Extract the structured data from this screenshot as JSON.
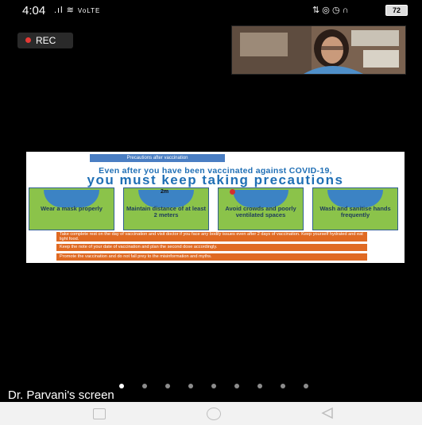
{
  "status_bar": {
    "time": "4:04",
    "network": "VoLTE",
    "battery": "72",
    "icons": [
      "signal-icon",
      "wifi-icon",
      "data-icon",
      "alarm-icon",
      "headphones-icon",
      "battery-icon"
    ]
  },
  "recording": {
    "label": "REC"
  },
  "slide": {
    "header": "Precautions after vaccination",
    "line1": "Even after you have been vaccinated against COVID-19,",
    "line2": "you must keep taking precautions",
    "panels": [
      {
        "label": "Wear a mask properly"
      },
      {
        "badge": "2m",
        "label": "Maintain distance of at least 2 meters"
      },
      {
        "label": "Avoid crowds and poorly ventilated spaces"
      },
      {
        "label": "Wash and sanitise hands frequently"
      }
    ],
    "bullets": [
      "Take complete rest on the day of vaccination and visit doctor if you face any bodily issues even after 2 days of vaccination. Keep yourself hydrated and eat light food.",
      "Keep the note of your date of vaccination and plan the second dose accordingly.",
      "Promote the vaccination and do not fall prey to the misinformation and myths."
    ]
  },
  "pager": {
    "count": 9,
    "active_index": 0
  },
  "caption": "Dr. Parvani's screen",
  "colors": {
    "background": "#000000",
    "slide_blue": "#1f6fb5",
    "panel_green": "#8bc34a",
    "bullet_orange": "#e06a23",
    "rec_red": "#e53935"
  }
}
